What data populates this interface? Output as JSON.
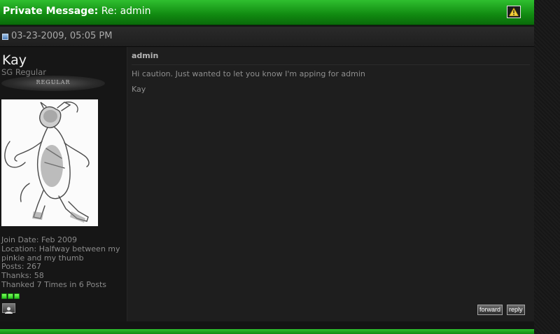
{
  "header": {
    "label": "Private Message:",
    "subject": " Re: admin"
  },
  "post": {
    "date": "03-23-2009, 05:05 PM"
  },
  "user": {
    "name": "Kay",
    "title": "SG Regular",
    "rank": "REGULAR",
    "join_date": "Join Date: Feb 2009",
    "location_line1": "Location: Halfway between my",
    "location_line2": "pinkie and my thumb",
    "posts": "Posts: 267",
    "thanks": "Thanks: 58",
    "thanked": "Thanked 7 Times in 6 Posts",
    "reputation_dots": 3
  },
  "message": {
    "subject": "admin",
    "line1": "Hi caution. Just wanted to let you know I'm apping for admin",
    "line2": "Kay"
  },
  "actions": {
    "forward": "forward",
    "reply": "reply"
  },
  "colors": {
    "header_green": "#118a11",
    "rep_green": "#27c41f"
  },
  "icons": [
    "warning-icon",
    "post-icon",
    "avatar-image",
    "profile-icon"
  ]
}
